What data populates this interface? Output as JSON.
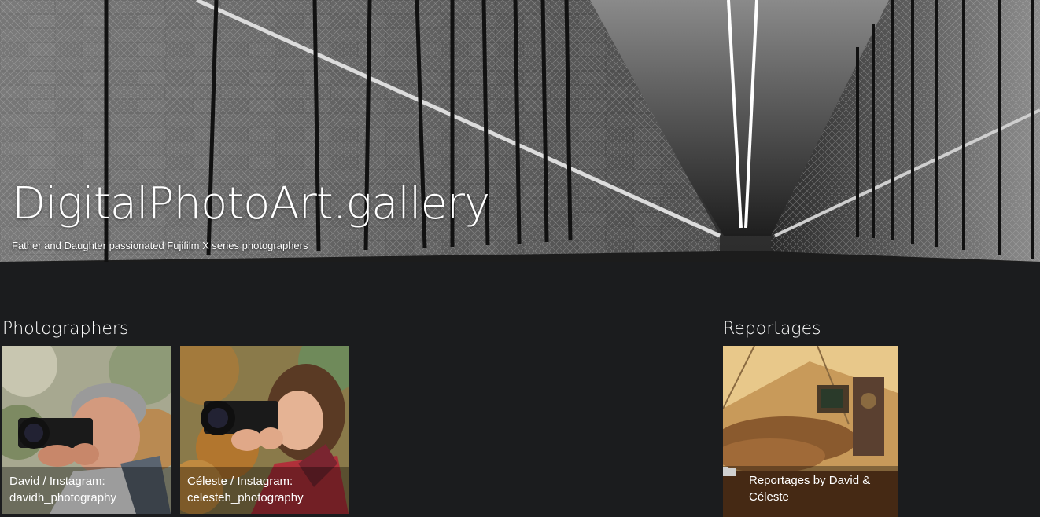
{
  "site": {
    "title": "DigitalPhotoArt.gallery",
    "subtitle": "Father and Daughter passionated Fujifilm X series photographers"
  },
  "sections": {
    "photographers": {
      "heading": "Photographers",
      "cards": [
        {
          "caption": "David / Instagram: davidh_photography"
        },
        {
          "caption": "Céleste / Instagram: celesteh_photography"
        }
      ]
    },
    "reportages": {
      "heading": "Reportages",
      "cards": [
        {
          "caption": "Reportages by David & Céleste",
          "icon": "folder-icon"
        }
      ]
    }
  },
  "colors": {
    "page_background": "#1b1c1e",
    "text": "#ffffff"
  }
}
